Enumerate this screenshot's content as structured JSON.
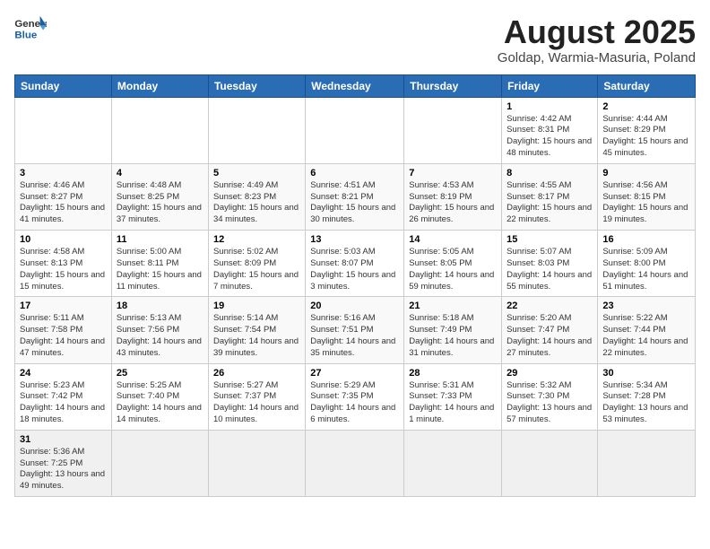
{
  "header": {
    "logo_general": "General",
    "logo_blue": "Blue",
    "month": "August 2025",
    "location": "Goldap, Warmia-Masuria, Poland"
  },
  "days_of_week": [
    "Sunday",
    "Monday",
    "Tuesday",
    "Wednesday",
    "Thursday",
    "Friday",
    "Saturday"
  ],
  "weeks": [
    [
      {
        "day": "",
        "info": ""
      },
      {
        "day": "",
        "info": ""
      },
      {
        "day": "",
        "info": ""
      },
      {
        "day": "",
        "info": ""
      },
      {
        "day": "",
        "info": ""
      },
      {
        "day": "1",
        "info": "Sunrise: 4:42 AM\nSunset: 8:31 PM\nDaylight: 15 hours and 48 minutes."
      },
      {
        "day": "2",
        "info": "Sunrise: 4:44 AM\nSunset: 8:29 PM\nDaylight: 15 hours and 45 minutes."
      }
    ],
    [
      {
        "day": "3",
        "info": "Sunrise: 4:46 AM\nSunset: 8:27 PM\nDaylight: 15 hours and 41 minutes."
      },
      {
        "day": "4",
        "info": "Sunrise: 4:48 AM\nSunset: 8:25 PM\nDaylight: 15 hours and 37 minutes."
      },
      {
        "day": "5",
        "info": "Sunrise: 4:49 AM\nSunset: 8:23 PM\nDaylight: 15 hours and 34 minutes."
      },
      {
        "day": "6",
        "info": "Sunrise: 4:51 AM\nSunset: 8:21 PM\nDaylight: 15 hours and 30 minutes."
      },
      {
        "day": "7",
        "info": "Sunrise: 4:53 AM\nSunset: 8:19 PM\nDaylight: 15 hours and 26 minutes."
      },
      {
        "day": "8",
        "info": "Sunrise: 4:55 AM\nSunset: 8:17 PM\nDaylight: 15 hours and 22 minutes."
      },
      {
        "day": "9",
        "info": "Sunrise: 4:56 AM\nSunset: 8:15 PM\nDaylight: 15 hours and 19 minutes."
      }
    ],
    [
      {
        "day": "10",
        "info": "Sunrise: 4:58 AM\nSunset: 8:13 PM\nDaylight: 15 hours and 15 minutes."
      },
      {
        "day": "11",
        "info": "Sunrise: 5:00 AM\nSunset: 8:11 PM\nDaylight: 15 hours and 11 minutes."
      },
      {
        "day": "12",
        "info": "Sunrise: 5:02 AM\nSunset: 8:09 PM\nDaylight: 15 hours and 7 minutes."
      },
      {
        "day": "13",
        "info": "Sunrise: 5:03 AM\nSunset: 8:07 PM\nDaylight: 15 hours and 3 minutes."
      },
      {
        "day": "14",
        "info": "Sunrise: 5:05 AM\nSunset: 8:05 PM\nDaylight: 14 hours and 59 minutes."
      },
      {
        "day": "15",
        "info": "Sunrise: 5:07 AM\nSunset: 8:03 PM\nDaylight: 14 hours and 55 minutes."
      },
      {
        "day": "16",
        "info": "Sunrise: 5:09 AM\nSunset: 8:00 PM\nDaylight: 14 hours and 51 minutes."
      }
    ],
    [
      {
        "day": "17",
        "info": "Sunrise: 5:11 AM\nSunset: 7:58 PM\nDaylight: 14 hours and 47 minutes."
      },
      {
        "day": "18",
        "info": "Sunrise: 5:13 AM\nSunset: 7:56 PM\nDaylight: 14 hours and 43 minutes."
      },
      {
        "day": "19",
        "info": "Sunrise: 5:14 AM\nSunset: 7:54 PM\nDaylight: 14 hours and 39 minutes."
      },
      {
        "day": "20",
        "info": "Sunrise: 5:16 AM\nSunset: 7:51 PM\nDaylight: 14 hours and 35 minutes."
      },
      {
        "day": "21",
        "info": "Sunrise: 5:18 AM\nSunset: 7:49 PM\nDaylight: 14 hours and 31 minutes."
      },
      {
        "day": "22",
        "info": "Sunrise: 5:20 AM\nSunset: 7:47 PM\nDaylight: 14 hours and 27 minutes."
      },
      {
        "day": "23",
        "info": "Sunrise: 5:22 AM\nSunset: 7:44 PM\nDaylight: 14 hours and 22 minutes."
      }
    ],
    [
      {
        "day": "24",
        "info": "Sunrise: 5:23 AM\nSunset: 7:42 PM\nDaylight: 14 hours and 18 minutes."
      },
      {
        "day": "25",
        "info": "Sunrise: 5:25 AM\nSunset: 7:40 PM\nDaylight: 14 hours and 14 minutes."
      },
      {
        "day": "26",
        "info": "Sunrise: 5:27 AM\nSunset: 7:37 PM\nDaylight: 14 hours and 10 minutes."
      },
      {
        "day": "27",
        "info": "Sunrise: 5:29 AM\nSunset: 7:35 PM\nDaylight: 14 hours and 6 minutes."
      },
      {
        "day": "28",
        "info": "Sunrise: 5:31 AM\nSunset: 7:33 PM\nDaylight: 14 hours and 1 minute."
      },
      {
        "day": "29",
        "info": "Sunrise: 5:32 AM\nSunset: 7:30 PM\nDaylight: 13 hours and 57 minutes."
      },
      {
        "day": "30",
        "info": "Sunrise: 5:34 AM\nSunset: 7:28 PM\nDaylight: 13 hours and 53 minutes."
      }
    ],
    [
      {
        "day": "31",
        "info": "Sunrise: 5:36 AM\nSunset: 7:25 PM\nDaylight: 13 hours and 49 minutes."
      },
      {
        "day": "",
        "info": ""
      },
      {
        "day": "",
        "info": ""
      },
      {
        "day": "",
        "info": ""
      },
      {
        "day": "",
        "info": ""
      },
      {
        "day": "",
        "info": ""
      },
      {
        "day": "",
        "info": ""
      }
    ]
  ]
}
